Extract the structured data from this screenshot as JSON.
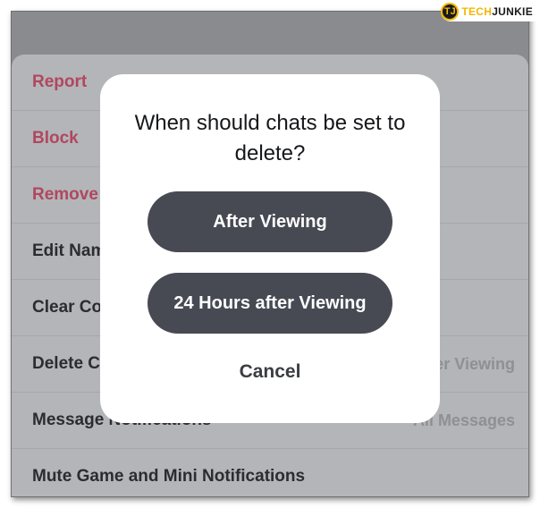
{
  "watermark": {
    "mark": "TJ",
    "brand_part1": "TECH",
    "brand_part2": "JUNKIE"
  },
  "menu": {
    "items": [
      {
        "label": "Report",
        "value": ""
      },
      {
        "label": "Block",
        "value": ""
      },
      {
        "label": "Remove",
        "value": ""
      },
      {
        "label": "Edit Nam",
        "value": ""
      },
      {
        "label": "Clear Co",
        "value": ""
      },
      {
        "label": "Delete C",
        "value": "er Viewing"
      },
      {
        "label": "Message Notifications",
        "value": "All Messages"
      },
      {
        "label": "Mute Game and Mini Notifications",
        "value": ""
      }
    ]
  },
  "dialog": {
    "title": "When should chats be set to delete?",
    "option_after_viewing": "After Viewing",
    "option_24_hours": "24 Hours after Viewing",
    "cancel": "Cancel"
  },
  "colors": {
    "destructive_text": "#b04760",
    "pill_button": "#474a53",
    "overlay_dim": "#8a8b8e"
  }
}
